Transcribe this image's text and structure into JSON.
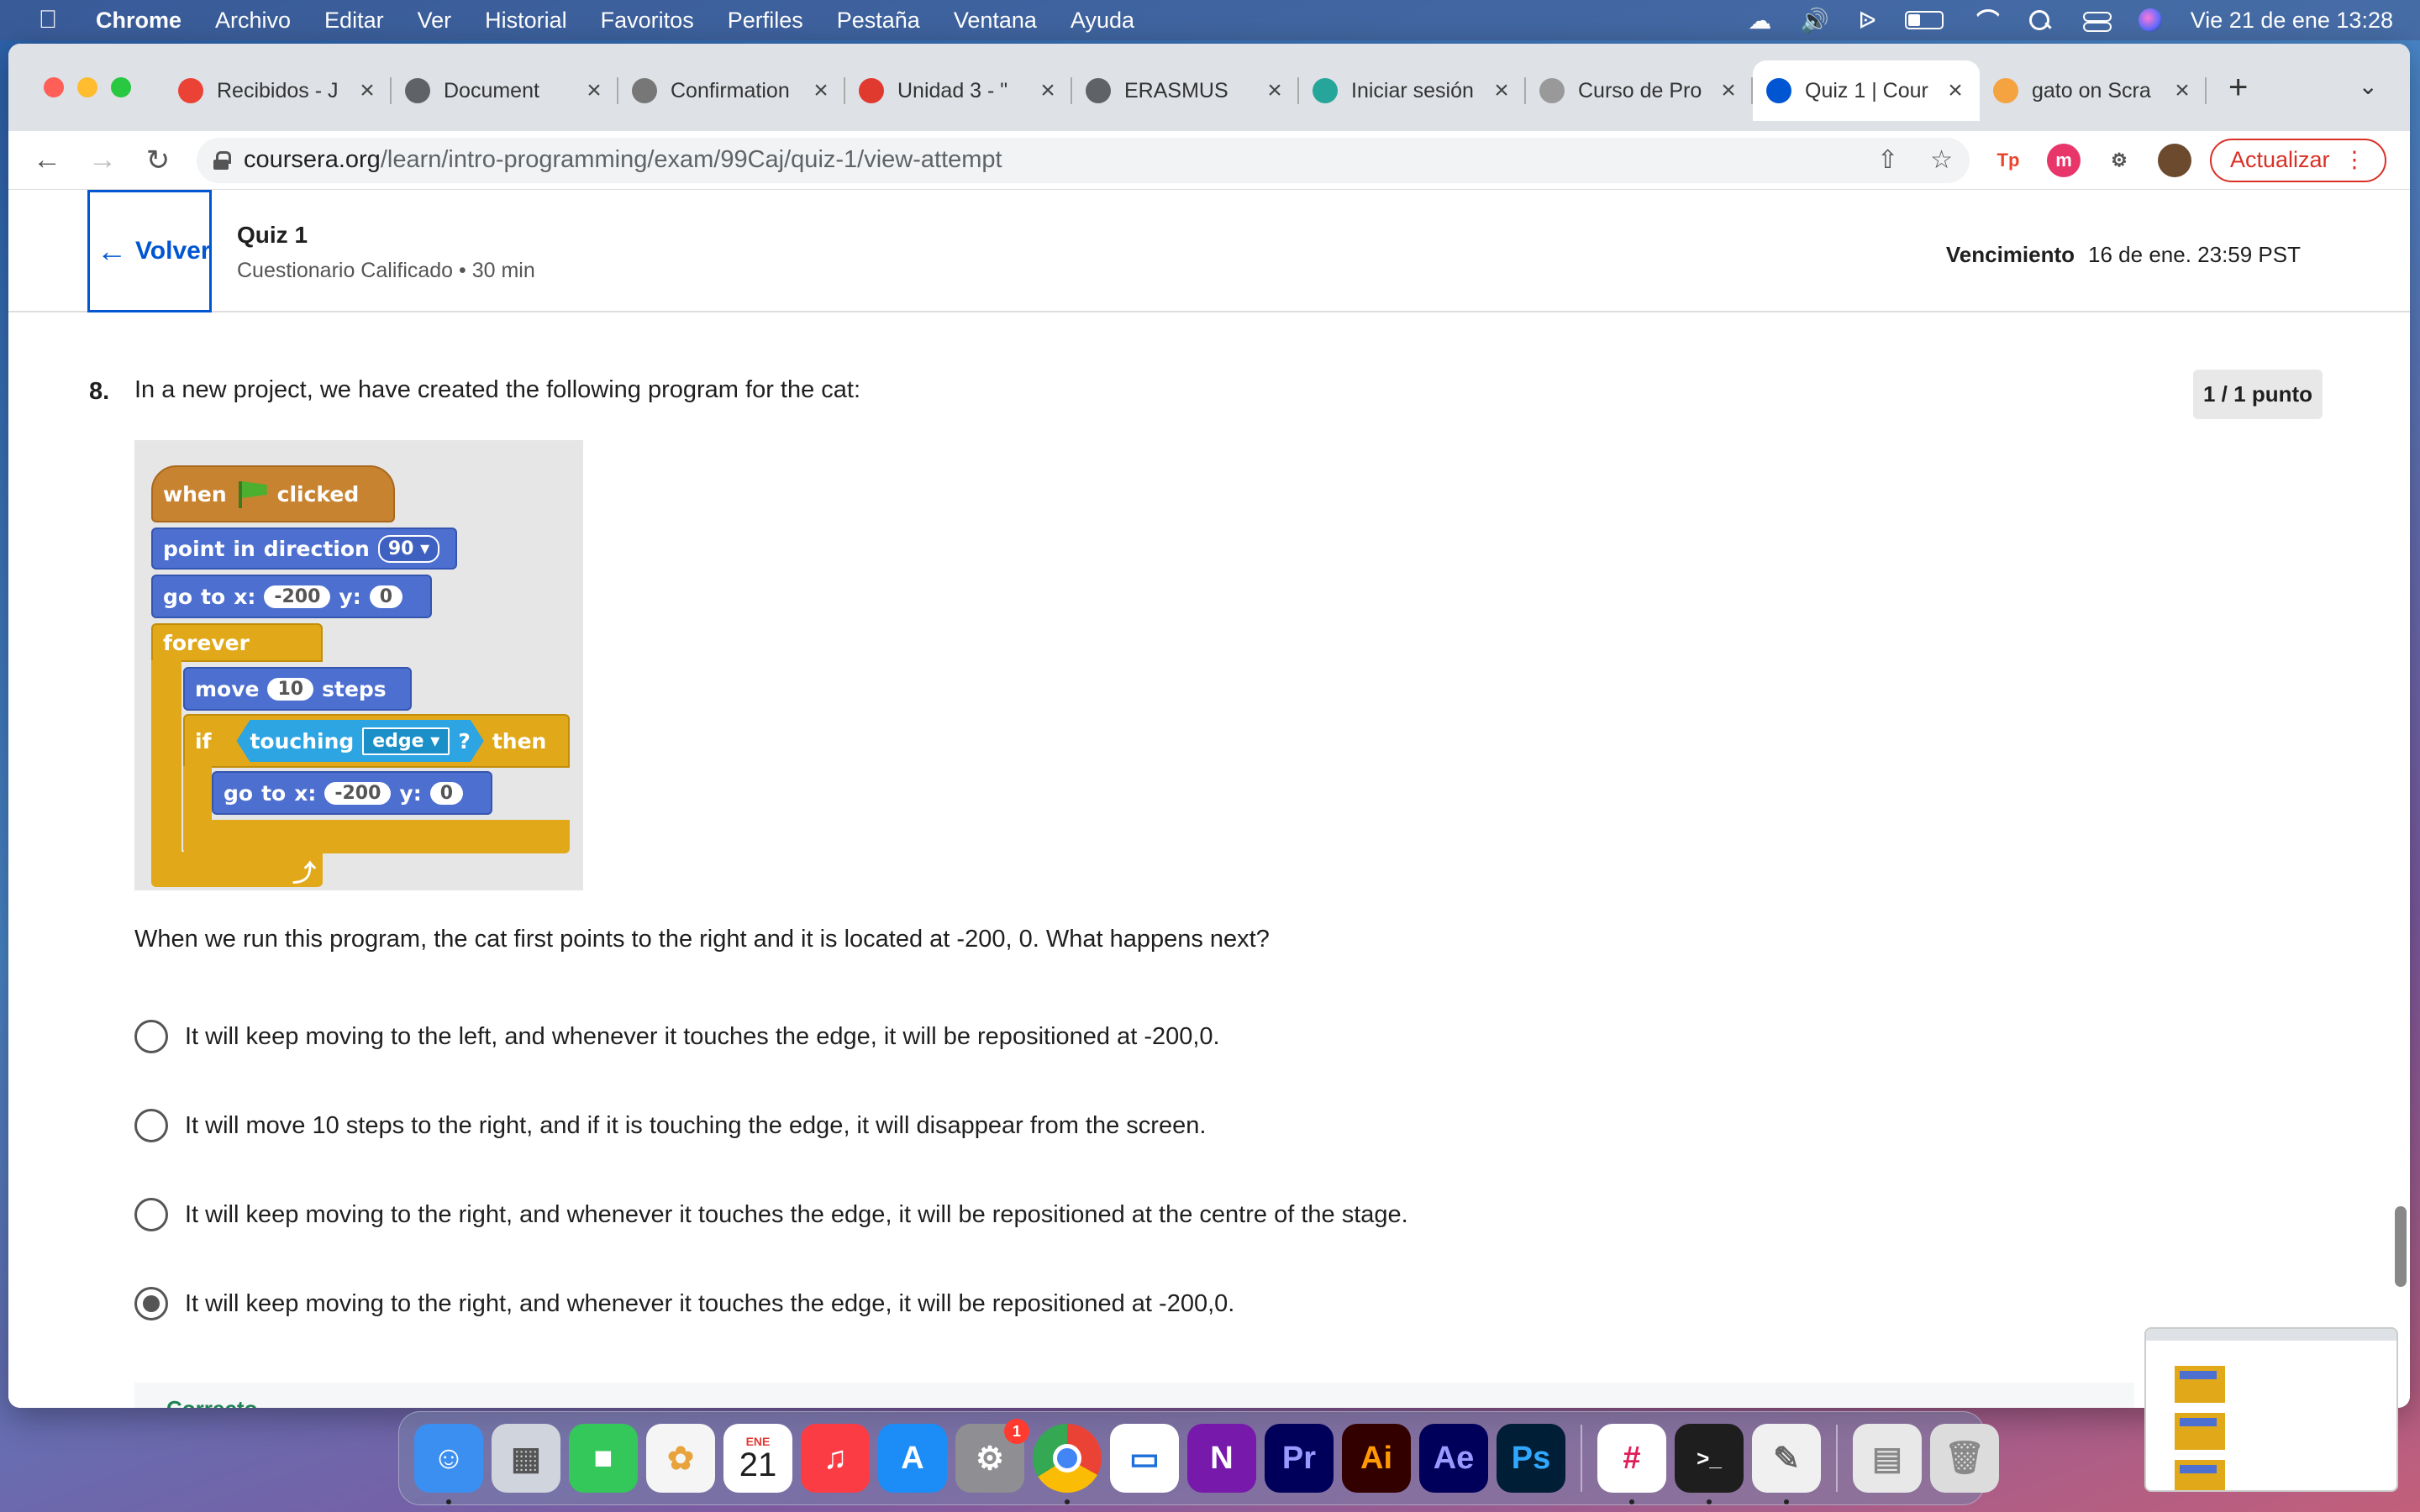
{
  "menubar": {
    "app": "Chrome",
    "items": [
      "Archivo",
      "Editar",
      "Ver",
      "Historial",
      "Favoritos",
      "Perfiles",
      "Pestaña",
      "Ventana",
      "Ayuda"
    ],
    "datetime": "Vie 21 de ene  13:28"
  },
  "tabs": [
    {
      "title": "Recibidos - J",
      "favicon": "gmail-icon",
      "color": "#ea4335"
    },
    {
      "title": "Document",
      "favicon": "globe-icon",
      "color": "#5f6368"
    },
    {
      "title": "Confirmation",
      "favicon": "gd-icon",
      "color": "#777777"
    },
    {
      "title": "Unidad 3 - \"",
      "favicon": "unidad-icon",
      "color": "#e03a2f"
    },
    {
      "title": "ERASMUS",
      "favicon": "globe-icon",
      "color": "#5f6368"
    },
    {
      "title": "Iniciar sesión",
      "favicon": "login-icon",
      "color": "#26a69a"
    },
    {
      "title": "Curso de Pro",
      "favicon": "curso-icon",
      "color": "#999999"
    },
    {
      "title": "Quiz 1 | Cour",
      "favicon": "coursera-icon",
      "color": "#0056d2",
      "active": true
    },
    {
      "title": "gato on Scra",
      "favicon": "scratch-icon",
      "color": "#f4a340"
    }
  ],
  "omnibox": {
    "domain": "coursera.org",
    "path": "/learn/intro-programming/exam/99Caj/quiz-1/view-attempt"
  },
  "toolbar": {
    "update_label": "Actualizar"
  },
  "quiz": {
    "back_label": "Volver",
    "title": "Quiz 1",
    "subtitle": "Cuestionario Calificado • 30 min",
    "due_label": "Vencimiento",
    "due_value": "16 de ene. 23:59 PST"
  },
  "question": {
    "number": "8.",
    "text": "In a new project, we have created the following program for the cat:",
    "points": "1 / 1 punto",
    "prompt": "When we run this program, the cat first points to the right and it is located at -200, 0. What happens next?",
    "options": [
      {
        "text": "It will keep moving to the left, and whenever it touches the edge, it will be repositioned at -200,0.",
        "selected": false
      },
      {
        "text": "It will move 10 steps to the right, and if it is touching the edge, it will disappear from the screen.",
        "selected": false
      },
      {
        "text": "It will keep moving to the right, and whenever it touches the edge, it will be repositioned at the centre of the stage.",
        "selected": false
      },
      {
        "text": "It will keep moving to the right, and whenever it touches the edge, it will be repositioned at -200,0.",
        "selected": true
      }
    ],
    "feedback": "Correcto"
  },
  "scratch": {
    "when": "when",
    "clicked": "clicked",
    "point": "point",
    "in": "in",
    "direction": "direction",
    "direction_value": "90",
    "go": "go",
    "to": "to",
    "x": "x:",
    "x_value": "-200",
    "y": "y:",
    "y_value": "0",
    "forever": "forever",
    "move": "move",
    "move_value": "10",
    "steps": "steps",
    "if": "if",
    "touching": "touching",
    "touching_value": "edge",
    "question_mark": "?",
    "then": "then"
  },
  "dock": {
    "calendar_month": "ENE",
    "calendar_day": "21",
    "settings_badge": "1",
    "apps": [
      {
        "name": "finder",
        "color": "#3b8ff0"
      },
      {
        "name": "launchpad",
        "color": "#d0d4dc"
      },
      {
        "name": "facetime",
        "color": "#34c759"
      },
      {
        "name": "photos",
        "color": "#f5f5f5"
      },
      {
        "name": "calendar",
        "color": "#ffffff"
      },
      {
        "name": "music",
        "color": "#fc3c44"
      },
      {
        "name": "app-store",
        "color": "#1c8cf7"
      },
      {
        "name": "system-preferences",
        "color": "#8e8e93"
      },
      {
        "name": "chrome",
        "color": "#ffffff"
      },
      {
        "name": "keynote",
        "color": "#ffffff"
      },
      {
        "name": "onenote",
        "color": "#7719aa"
      },
      {
        "name": "premiere",
        "color": "#00005b"
      },
      {
        "name": "illustrator",
        "color": "#330000"
      },
      {
        "name": "after-effects",
        "color": "#00005b"
      },
      {
        "name": "photoshop",
        "color": "#001e36"
      },
      {
        "name": "slack",
        "color": "#ffffff"
      },
      {
        "name": "terminal",
        "color": "#1e1e1e"
      },
      {
        "name": "textedit",
        "color": "#f0f0f0"
      },
      {
        "name": "document",
        "color": "#e8e8e8"
      },
      {
        "name": "trash",
        "color": "#dcdcdc"
      }
    ],
    "labels": {
      "premiere": "Pr",
      "illustrator": "Ai",
      "after_effects": "Ae",
      "photoshop": "Ps",
      "onenote": "N",
      "terminal": ">_"
    }
  }
}
